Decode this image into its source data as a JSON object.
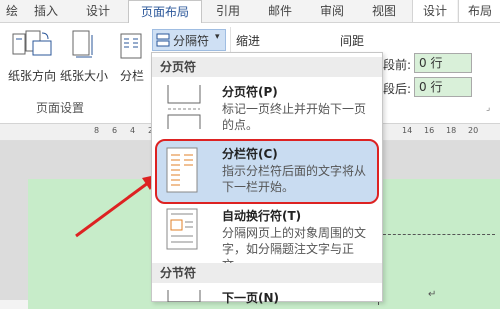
{
  "tabs": [
    {
      "label": "绘",
      "id": "t0"
    },
    {
      "label": "插入",
      "id": "t1"
    },
    {
      "label": "设计",
      "id": "t2"
    },
    {
      "label": "页面布局",
      "id": "t3",
      "active": true
    },
    {
      "label": "引用",
      "id": "t4"
    },
    {
      "label": "邮件",
      "id": "t5"
    },
    {
      "label": "审阅",
      "id": "t6"
    },
    {
      "label": "视图",
      "id": "t7"
    },
    {
      "label": "设计",
      "id": "t8"
    },
    {
      "label": "布局",
      "id": "t9"
    }
  ],
  "ribbon": {
    "orientation_label": "纸张方向",
    "size_label": "纸张大小",
    "columns_label": "分栏",
    "breaks_label": "分隔符",
    "indent_label": "缩进",
    "spacing_label": "间距",
    "before_label": "段前:",
    "after_label": "段后:",
    "before_value": "0 行",
    "after_value": "0 行",
    "page_setup_group": "页面设置"
  },
  "ruler": {
    "ticks": [
      "8",
      "6",
      "4",
      "2",
      "14",
      "16",
      "18",
      "20"
    ]
  },
  "menu": {
    "section_page": "分页符",
    "section_section": "分节符",
    "items": [
      {
        "title": "分页符(P)",
        "desc": "标记一页终止并开始下一页的点。"
      },
      {
        "title": "分栏符(C)",
        "desc": "指示分栏符后面的文字将从下一栏开始。"
      },
      {
        "title": "自动换行符(T)",
        "desc": "分隔网页上的对象周围的文字，如分隔题注文字与正文。"
      },
      {
        "title": "下一页(N)",
        "desc": ""
      }
    ]
  },
  "colors": {
    "accent": "#2b579a",
    "highlight": "#c9dcf1",
    "arrow": "#d22"
  }
}
